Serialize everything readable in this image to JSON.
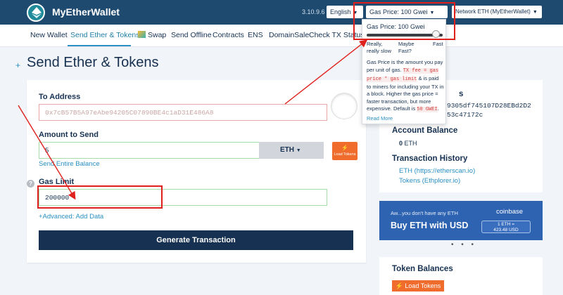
{
  "header": {
    "brand": "MyEtherWallet",
    "version": "3.10.9.6",
    "language": "English",
    "gas_price": "Gas Price: 100 Gwei",
    "network": "Network ETH (MyEtherWallet)"
  },
  "nav": {
    "items": [
      {
        "label": "New Wallet"
      },
      {
        "label": "Send Ether & Tokens"
      },
      {
        "label": "Swap"
      },
      {
        "label": "Send Offline"
      },
      {
        "label": "Contracts"
      },
      {
        "label": "ENS"
      },
      {
        "label": "DomainSale"
      },
      {
        "label": "Check TX Status"
      }
    ]
  },
  "page": {
    "plus": "+",
    "title": "Send Ether & Tokens"
  },
  "form": {
    "to_address_label": "To Address",
    "to_address_placeholder": "0x7cB57B5A97eAbe94205C07890BE4c1aD31E486A8",
    "amount_label": "Amount to Send",
    "amount_value": "5",
    "currency": "ETH",
    "load_tokens_small": "Load Tokens",
    "send_entire_balance": "Send Entire Balance",
    "gas_help": "?",
    "gas_limit_label": "Gas Limit",
    "gas_limit_value": "200000",
    "advanced_link": "+Advanced: Add Data",
    "generate_button": "Generate Transaction"
  },
  "sidebar": {
    "address_label_fragment": "s",
    "address_line1": "9305df745107D28EBd2D2",
    "address_line2": "53c47172c",
    "account_balance_label": "Account Balance",
    "balance_value": "0",
    "balance_unit": "ETH",
    "tx_history_label": "Transaction History",
    "etherscan_link": "ETH (https://etherscan.io)",
    "ethplorer_link": "Tokens (Ethplorer.io)",
    "coinbase_small": "Aw...you don't have any ETH",
    "coinbase_big": "Buy ETH with USD",
    "coinbase_brand": "coinbase",
    "coinbase_rate_line1": "1 ETH =",
    "coinbase_rate_line2": "423.48 USD",
    "dots": "• • •",
    "token_balances_label": "Token Balances",
    "load_tokens_button": "Load Tokens"
  },
  "gas_popup": {
    "title": "Gas Price: 100 Gwei",
    "slider_fraction": 0.96,
    "label_slow": "Really, really slow",
    "label_maybe": "Maybe Fast?",
    "label_fast": "Fast",
    "desc_part1": "Gas Price is the amount you pay per unit of gas.",
    "code_fee": "TX fee = gas price * gas limit",
    "desc_part2": "& is paid to miners for including your TX in a block. Higher the gas price = faster transaction, but more expensive. Default is",
    "code_default": "50 GWEI",
    "desc_part3": ".",
    "read_more": "Read More"
  },
  "colors": {
    "header_bg": "#1f4a70",
    "accent_blue": "#2a8fc2",
    "navy_button": "#163151",
    "orange": "#ef6c2c",
    "annotation_red": "#e0201c",
    "coinbase_blue": "#2e63b2"
  }
}
